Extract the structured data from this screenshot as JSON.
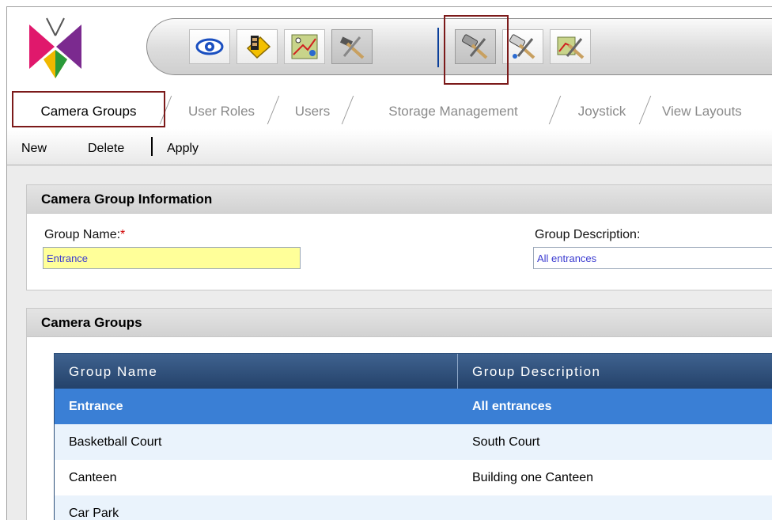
{
  "toolbar": {
    "buttons": [
      {
        "name": "eye",
        "pressed": false
      },
      {
        "name": "film-tag",
        "pressed": false
      },
      {
        "name": "map-route",
        "pressed": false
      },
      {
        "name": "tools",
        "pressed": true
      },
      {
        "name": "camera-tools",
        "pressed": true,
        "highlighted": true
      },
      {
        "name": "camera-tools-alt",
        "pressed": false
      },
      {
        "name": "map-tools",
        "pressed": false
      }
    ]
  },
  "tabs": [
    {
      "label": "Camera Groups",
      "active": true
    },
    {
      "label": "User Roles",
      "active": false
    },
    {
      "label": "Users",
      "active": false
    },
    {
      "label": "Storage Management",
      "active": false
    },
    {
      "label": "Joystick",
      "active": false
    },
    {
      "label": "View Layouts",
      "active": false
    }
  ],
  "actions": {
    "new": "New",
    "delete": "Delete",
    "apply": "Apply"
  },
  "info_panel": {
    "title": "Camera Group Information",
    "group_name_label": "Group Name:",
    "required_marker": "*",
    "group_name_value": "Entrance",
    "group_description_label": "Group Description:",
    "group_description_value": "All entrances"
  },
  "groups_panel": {
    "title": "Camera Groups",
    "columns": [
      "Group Name",
      "Group Description"
    ],
    "rows": [
      {
        "name": "Entrance",
        "description": "All entrances",
        "selected": true
      },
      {
        "name": "Basketball Court",
        "description": "South Court",
        "selected": false
      },
      {
        "name": "Canteen",
        "description": "Building one Canteen",
        "selected": false
      },
      {
        "name": "Car Park",
        "description": "",
        "selected": false
      }
    ]
  },
  "colors": {
    "highlight_border": "#7c1a1a",
    "grid_header": "#2f5380",
    "selected_row": "#3a7fd5",
    "required_field_bg": "#ffff99"
  }
}
